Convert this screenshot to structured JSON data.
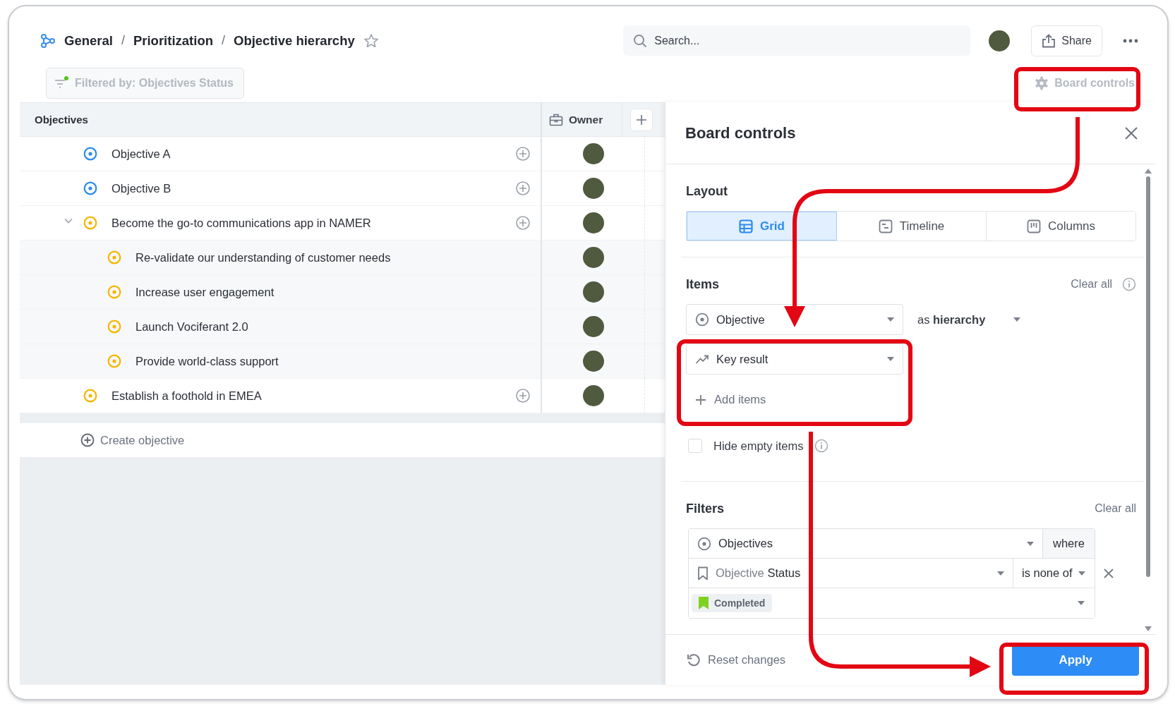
{
  "breadcrumb": [
    {
      "label": "General"
    },
    {
      "separator": "/",
      "label": "Prioritization"
    },
    {
      "separator": "/",
      "label": "Objective hierarchy"
    }
  ],
  "search": {
    "placeholder": "Search..."
  },
  "share_button": "Share",
  "filter_chip": {
    "label": "Filtered by: Objectives Status",
    "active": true
  },
  "board_controls_button": "Board controls",
  "table": {
    "columns": [
      "Objectives",
      "Owner"
    ],
    "rows": [
      {
        "name": "Objective A",
        "color": "#2d8cf0"
      },
      {
        "name": "Objective B",
        "color": "#2d8cf0"
      },
      {
        "name": "Become the go-to communications app in NAMER",
        "color": "#f7b500",
        "expanded": true,
        "children": [
          {
            "name": "Re-validate our understanding of customer needs",
            "color": "#f7b500"
          },
          {
            "name": "Increase user engagement",
            "color": "#f7b500"
          },
          {
            "name": "Launch Vociferant 2.0",
            "color": "#f7b500"
          },
          {
            "name": "Provide world-class support",
            "color": "#f7b500"
          }
        ]
      },
      {
        "name": "Establish a foothold in EMEA",
        "color": "#f7b500"
      }
    ],
    "create_label": "Create objective"
  },
  "panel": {
    "title": "Board controls",
    "layout": {
      "label": "Layout",
      "options": [
        {
          "label": "Grid",
          "selected": true
        },
        {
          "label": "Timeline",
          "selected": false
        },
        {
          "label": "Columns",
          "selected": false
        }
      ]
    },
    "items": {
      "label": "Items",
      "clear_label": "Clear all",
      "levels": [
        {
          "label": "Objective",
          "kind": "objective"
        },
        {
          "label": "Key result",
          "kind": "key-result"
        }
      ],
      "display": "as **hierarchy**",
      "add_label": "Add items",
      "hide_empty": {
        "label": "Hide empty items",
        "checked": false
      }
    },
    "filters": {
      "label": "Filters",
      "clear_label": "Clear all",
      "entity": "Objectives",
      "joiner": "where",
      "field_prefix": "Objective",
      "field": "Status",
      "operator": "is none of",
      "values": [
        {
          "label": "Completed",
          "color": "#7ed321"
        }
      ]
    },
    "footer": {
      "reset_label": "Reset changes",
      "apply_label": "Apply"
    }
  }
}
